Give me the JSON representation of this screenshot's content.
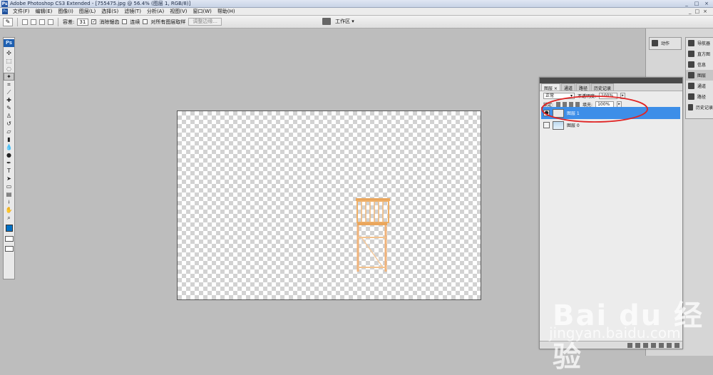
{
  "window": {
    "title": "Adobe Photoshop CS3 Extended - [755475.jpg @ 56.4% (图层 1, RGB/8)]",
    "controls": [
      "_",
      "□",
      "×"
    ]
  },
  "menu": {
    "ps_label": "Ps",
    "items": [
      "文件(F)",
      "编辑(E)",
      "图像(I)",
      "图层(L)",
      "选择(S)",
      "滤镜(T)",
      "分析(A)",
      "视图(V)",
      "窗口(W)",
      "帮助(H)"
    ],
    "doc_controls": [
      "_",
      "□",
      "×"
    ]
  },
  "options": {
    "tolerance_label": "容差:",
    "tolerance_value": "31",
    "antialias_label": "消除锯齿",
    "contiguous_label": "连续",
    "all_layers_label": "对所有图层取样",
    "refine_edge_label": "调整边缘...",
    "workspace_label": "工作区 ▾"
  },
  "toolbox": {
    "logo": "Ps"
  },
  "right_panels": {
    "col1": [
      {
        "label": "动作",
        "icon": "actions-icon"
      }
    ],
    "col2": [
      {
        "label": "导航器",
        "icon": "navigator-icon"
      },
      {
        "label": "直方图",
        "icon": "histogram-icon"
      },
      {
        "label": "信息",
        "icon": "info-icon"
      },
      {
        "label": "图层",
        "icon": "layers-icon"
      },
      {
        "label": "通道",
        "icon": "channels-icon"
      },
      {
        "label": "路径",
        "icon": "paths-icon"
      },
      {
        "label": "历史记录",
        "icon": "history-icon"
      }
    ]
  },
  "layers_panel": {
    "tabs": [
      "图层 ×",
      "通道",
      "路径",
      "历史记录"
    ],
    "blend_mode": "正常",
    "opacity_label": "不透明度:",
    "opacity_value": "100%",
    "lock_label": "锁定:",
    "fill_label": "填充:",
    "fill_value": "100%",
    "layers": [
      {
        "name": "图层 1",
        "visible": true,
        "selected": true
      },
      {
        "name": "图层 0",
        "visible": false,
        "selected": false
      }
    ]
  },
  "colors": {
    "accent": "#3d8ee8",
    "annotation": "#e02424",
    "foreground": "#0071c6"
  },
  "watermark": {
    "logo_text": "Bai du 经验",
    "url": "jingyan.baidu.com"
  }
}
